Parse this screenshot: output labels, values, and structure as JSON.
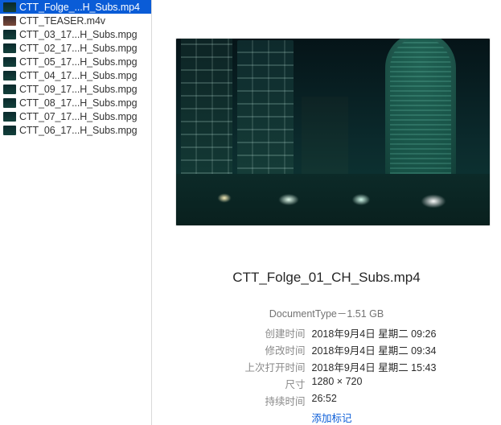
{
  "sidebar": {
    "items": [
      {
        "label": "CTT_Folge_...H_Subs.mp4",
        "thumb": "night",
        "selected": true
      },
      {
        "label": "CTT_TEASER.m4v",
        "thumb": "teaser",
        "selected": false
      },
      {
        "label": "CTT_03_17...H_Subs.mpg",
        "thumb": "night",
        "selected": false
      },
      {
        "label": "CTT_02_17...H_Subs.mpg",
        "thumb": "night",
        "selected": false
      },
      {
        "label": "CTT_05_17...H_Subs.mpg",
        "thumb": "night",
        "selected": false
      },
      {
        "label": "CTT_04_17...H_Subs.mpg",
        "thumb": "night",
        "selected": false
      },
      {
        "label": "CTT_09_17...H_Subs.mpg",
        "thumb": "night",
        "selected": false
      },
      {
        "label": "CTT_08_17...H_Subs.mpg",
        "thumb": "night",
        "selected": false
      },
      {
        "label": "CTT_07_17...H_Subs.mpg",
        "thumb": "night",
        "selected": false
      },
      {
        "label": "CTT_06_17...H_Subs.mpg",
        "thumb": "night",
        "selected": false
      }
    ]
  },
  "preview": {
    "title": "CTT_Folge_01_CH_Subs.mp4",
    "doc_line": "DocumentType－1.51 GB",
    "meta": [
      {
        "k": "创建时间",
        "v": "2018年9月4日 星期二 09:26"
      },
      {
        "k": "修改时间",
        "v": "2018年9月4日 星期二 09:34"
      },
      {
        "k": "上次打开时间",
        "v": "2018年9月4日 星期二 15:43"
      },
      {
        "k": "尺寸",
        "v": "1280 × 720"
      },
      {
        "k": "持续时间",
        "v": "26:52"
      }
    ],
    "add_tags": "添加标记"
  }
}
